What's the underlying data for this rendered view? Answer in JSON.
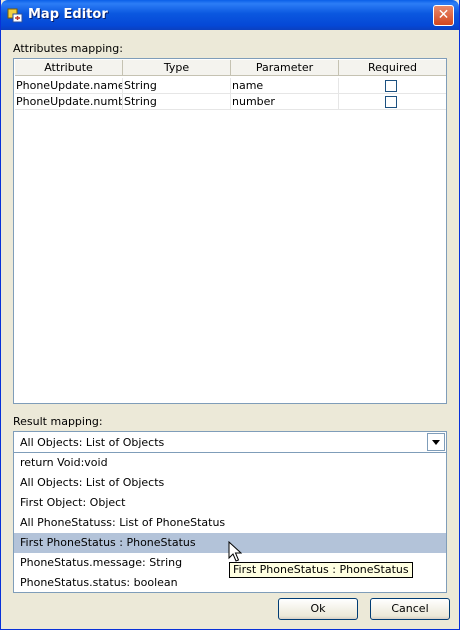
{
  "window": {
    "title": "Map Editor",
    "close_glyph": "✕"
  },
  "attributes": {
    "label": "Attributes mapping:",
    "columns": [
      "Attribute",
      "Type",
      "Parameter",
      "Required"
    ],
    "rows": [
      {
        "attribute": "PhoneUpdate.name",
        "type": "String",
        "parameter": "name",
        "required": false
      },
      {
        "attribute": "PhoneUpdate.number",
        "type": "String",
        "parameter": "number",
        "required": false
      }
    ]
  },
  "result": {
    "label": "Result mapping:",
    "selected_value": "All Objects: List of Objects",
    "options": [
      "return Void:void",
      "All Objects: List of Objects",
      "First Object: Object",
      "All PhoneStatuss: List of PhoneStatus",
      "First PhoneStatus : PhoneStatus",
      "PhoneStatus.message: String",
      "PhoneStatus.status: boolean"
    ],
    "highlighted_option": "First PhoneStatus : PhoneStatus"
  },
  "tooltip": {
    "text": "First PhoneStatus : PhoneStatus"
  },
  "buttons": {
    "ok": "Ok",
    "cancel": "Cancel"
  },
  "colors": {
    "title_bar": "#0a5fe8",
    "selection": "#b3c3d9",
    "tooltip_bg": "#ffffe1",
    "close": "#d2461f"
  }
}
